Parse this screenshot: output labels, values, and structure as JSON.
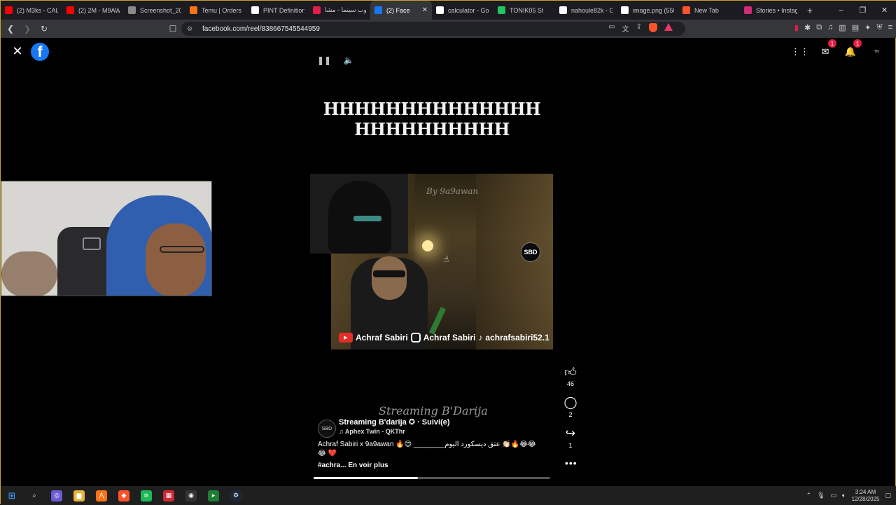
{
  "browser": {
    "tabs": [
      {
        "label": "(2) M3ks - CAL",
        "color": "#ff0000"
      },
      {
        "label": "(2) 2M - M9AW",
        "color": "#ff0000"
      },
      {
        "label": "Screenshot_202",
        "color": "#8a8a8a"
      },
      {
        "label": "Temu | Orders",
        "color": "#f97316"
      },
      {
        "label": "PINT Definition",
        "color": "#ffffff"
      },
      {
        "label": "توب سينما - مشا",
        "color": "#e11d48"
      },
      {
        "label": "(2) Face",
        "color": "#1877f2",
        "active": true
      },
      {
        "label": "calculator - Goo",
        "color": "#ffffff"
      },
      {
        "label": "TONIK05 St",
        "color": "#22c55e"
      },
      {
        "label": "nahoule82k - G",
        "color": "#ffffff"
      },
      {
        "label": "image.png (550",
        "color": "#ffffff"
      },
      {
        "label": "New Tab",
        "color": "#fb542b"
      },
      {
        "label": "Stories • Instag",
        "color": "#d62976"
      }
    ],
    "new_tab": "+",
    "url": "facebook.com/reel/838667545544959",
    "window_controls": [
      "–",
      "❐",
      "✕"
    ]
  },
  "facebook": {
    "logo_letter": "f",
    "close_icon": "✕",
    "notifications": {
      "messenger_count": "1",
      "bell_count": "1"
    },
    "account_icon": "ᵀᴺ"
  },
  "reel": {
    "headline": "HHHHHHHHHHHHHH HHHHHHHHHH",
    "video_watermark": "By 9a9awan",
    "logo_text": "SBD",
    "social_handles": [
      "Achraf Sabiri",
      "Achraf Sabiri",
      "achrafsabiri52.1"
    ],
    "likes": "46",
    "comments": "2",
    "shares": "1",
    "brand_script": "Streaming B'Darija",
    "page_name": "Streaming B'darija ✪ · Suivi(e)",
    "audio": "♫ Aphex Twin - QKThr",
    "caption": "Achraf Sabiri x 9a9awan 🔥😍 ________عتق ديسكورد اليوم 👏🏻🔥😂😂😂 ❤️",
    "see_more": "#achra... En voir plus",
    "progress_fraction": 0.44
  },
  "taskbar": {
    "time": "3:24 AM",
    "date": "12/28/2025",
    "apps": [
      {
        "name": "search",
        "color": "#1f1f1f",
        "glyph": "⌕"
      },
      {
        "name": "copilot",
        "color": "#6b5bd6",
        "glyph": "◎"
      },
      {
        "name": "explorer",
        "color": "#e8b339",
        "glyph": "▆"
      },
      {
        "name": "anti",
        "color": "#f97316",
        "glyph": "⋀"
      },
      {
        "name": "brave",
        "color": "#fb542b",
        "glyph": "◆"
      },
      {
        "name": "spotify",
        "color": "#1db954",
        "glyph": "≋"
      },
      {
        "name": "voicemod",
        "color": "#cc2936",
        "glyph": "▦"
      },
      {
        "name": "obs",
        "color": "#333333",
        "glyph": "◉"
      },
      {
        "name": "terminal",
        "color": "#1e7e34",
        "glyph": "▸"
      },
      {
        "name": "steam",
        "color": "#1b2838",
        "glyph": "⚙"
      }
    ]
  }
}
